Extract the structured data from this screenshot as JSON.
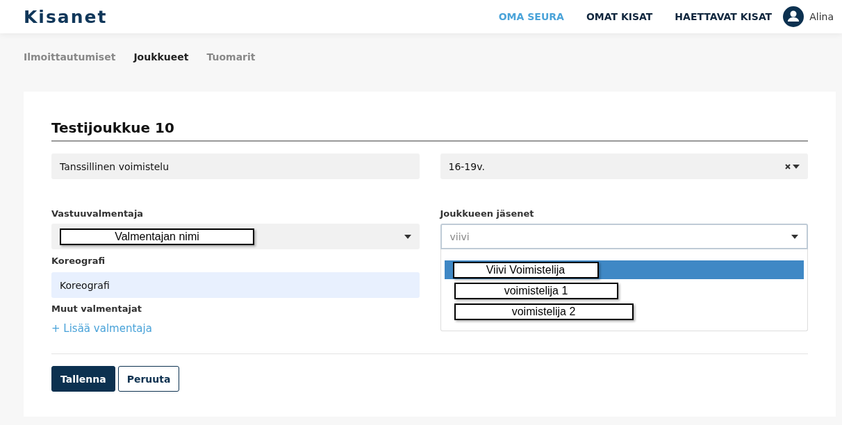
{
  "header": {
    "logo": "Kisanet",
    "nav": [
      {
        "label": "OMA SEURA",
        "selected": true
      },
      {
        "label": "OMAT KISAT",
        "selected": false
      },
      {
        "label": "HAETTAVAT KISAT",
        "selected": false
      }
    ],
    "user": "Alina"
  },
  "tabs": [
    {
      "label": "Ilmoittautumiset",
      "selected": false
    },
    {
      "label": "Joukkueet",
      "selected": true
    },
    {
      "label": "Tuomarit",
      "selected": false
    }
  ],
  "form": {
    "title": "Testijoukkue 10",
    "sport": {
      "value": "Tanssillinen voimistelu"
    },
    "age_group": {
      "value": "16-19v.",
      "clearable": true
    },
    "head_coach": {
      "label": "Vastuuvalmentaja",
      "value": "Valmentajan nimi"
    },
    "choreographer": {
      "label": "Koreografi",
      "value": "Koreografi"
    },
    "other_coaches": {
      "label": "Muut valmentajat",
      "add_link": "+ Lisää valmentaja"
    },
    "members": {
      "label": "Joukkueen jäsenet",
      "value": "viivi",
      "open": true,
      "options": [
        {
          "label": "Viivi Voimistelija",
          "selected": true
        },
        {
          "label": "voimistelija 1",
          "selected": false
        },
        {
          "label": "voimistelija 2",
          "selected": false
        }
      ]
    },
    "buttons": [
      {
        "label": "Tallenna",
        "kind": "primary"
      },
      {
        "label": "Peruuta",
        "kind": "secondary"
      }
    ]
  }
}
